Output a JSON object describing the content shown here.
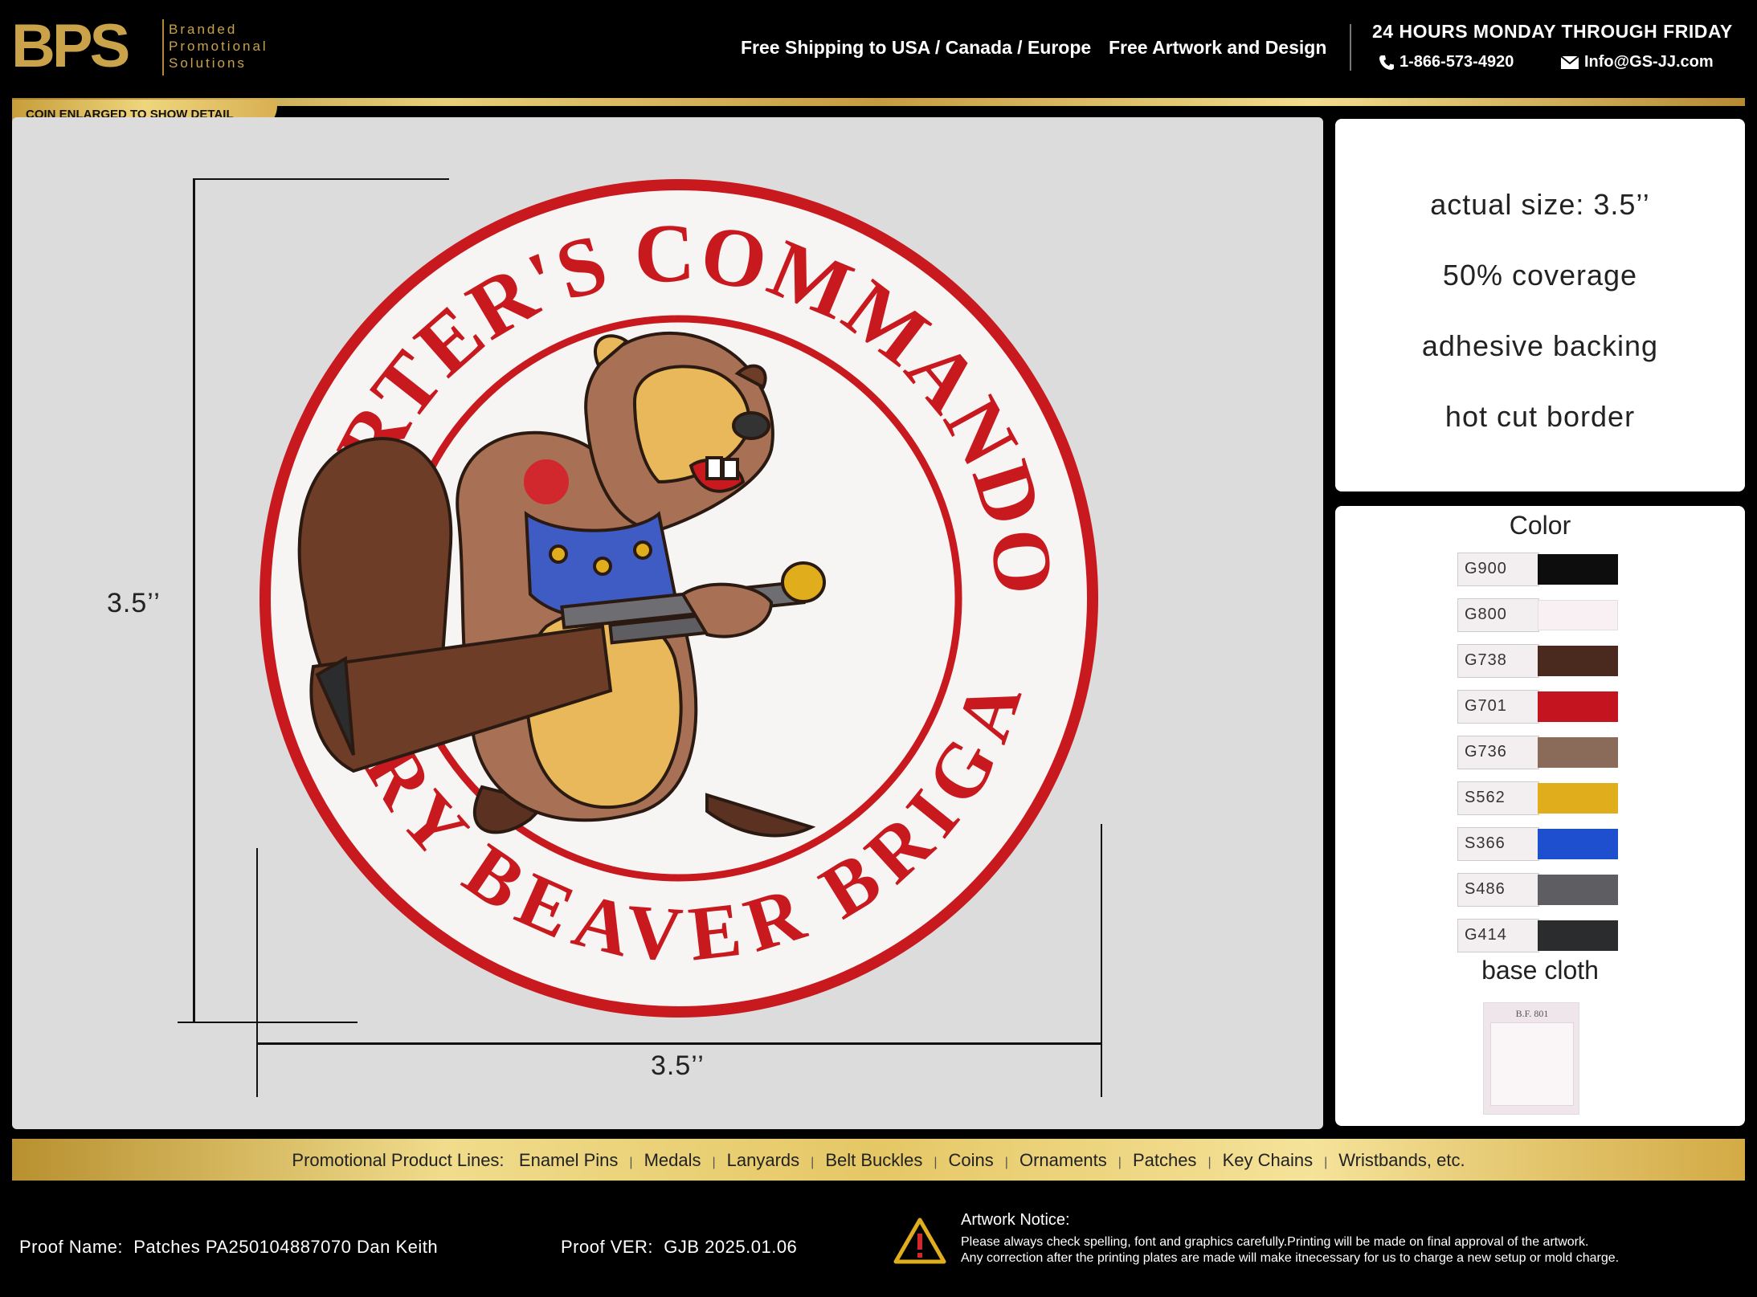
{
  "header": {
    "logo_mark": "BPS",
    "logo_lines": [
      "Branded",
      "Promotional",
      "Solutions"
    ],
    "link_shipping": "Free Shipping to USA / Canada / Europe",
    "link_artwork": "Free Artwork and Design",
    "hours": "24 HOURS MONDAY THROUGH FRIDAY",
    "phone": "1-866-573-4920",
    "email": "Info@GS-JJ.com"
  },
  "banner": {
    "enlarged_label": "COIN ENLARGED TO SHOW DETAIL"
  },
  "main": {
    "height_label": "3.5’’",
    "width_label": "3.5’’",
    "patch": {
      "top_text": "CARTER'S  COMMANDO",
      "bottom_text": "ANGRY BEAVER BRIGADE"
    }
  },
  "specs": {
    "actual_size": "actual size: 3.5’’",
    "coverage": "50% coverage",
    "backing": "adhesive backing",
    "border": "hot cut border"
  },
  "colors": {
    "title": "Color",
    "swatches": [
      {
        "code": "G900",
        "hex": "#0d0d0d"
      },
      {
        "code": "G800",
        "hex": "#f8f0f2"
      },
      {
        "code": "G738",
        "hex": "#4a2a1e"
      },
      {
        "code": "G701",
        "hex": "#c4141f"
      },
      {
        "code": "G736",
        "hex": "#8a6a58"
      },
      {
        "code": "S562",
        "hex": "#e0ad1c"
      },
      {
        "code": "S366",
        "hex": "#1d4fcf"
      },
      {
        "code": "S486",
        "hex": "#5e5e62"
      },
      {
        "code": "G414",
        "hex": "#2a2c2e"
      }
    ],
    "base_title": "base cloth",
    "base_code": "B.F. 801"
  },
  "product_lines": {
    "label": "Promotional Product Lines:",
    "items": [
      "Enamel Pins",
      "Medals",
      "Lanyards",
      "Belt Buckles",
      "Coins",
      "Ornaments",
      "Patches",
      "Key Chains",
      "Wristbands, etc."
    ]
  },
  "footer": {
    "proof_name_label": "Proof Name:",
    "proof_name": "Patches PA250104887070 Dan Keith",
    "proof_ver_label": "Proof VER:",
    "proof_ver": "GJB 2025.01.06",
    "notice_title": "Artwork Notice:",
    "notice_line1": "Please always check spelling, font and graphics carefully.Printing will be made on final approval of the artwork.",
    "notice_line2": "Any correction after the printing plates are made will make itnecessary for us to charge a new setup or mold charge."
  }
}
